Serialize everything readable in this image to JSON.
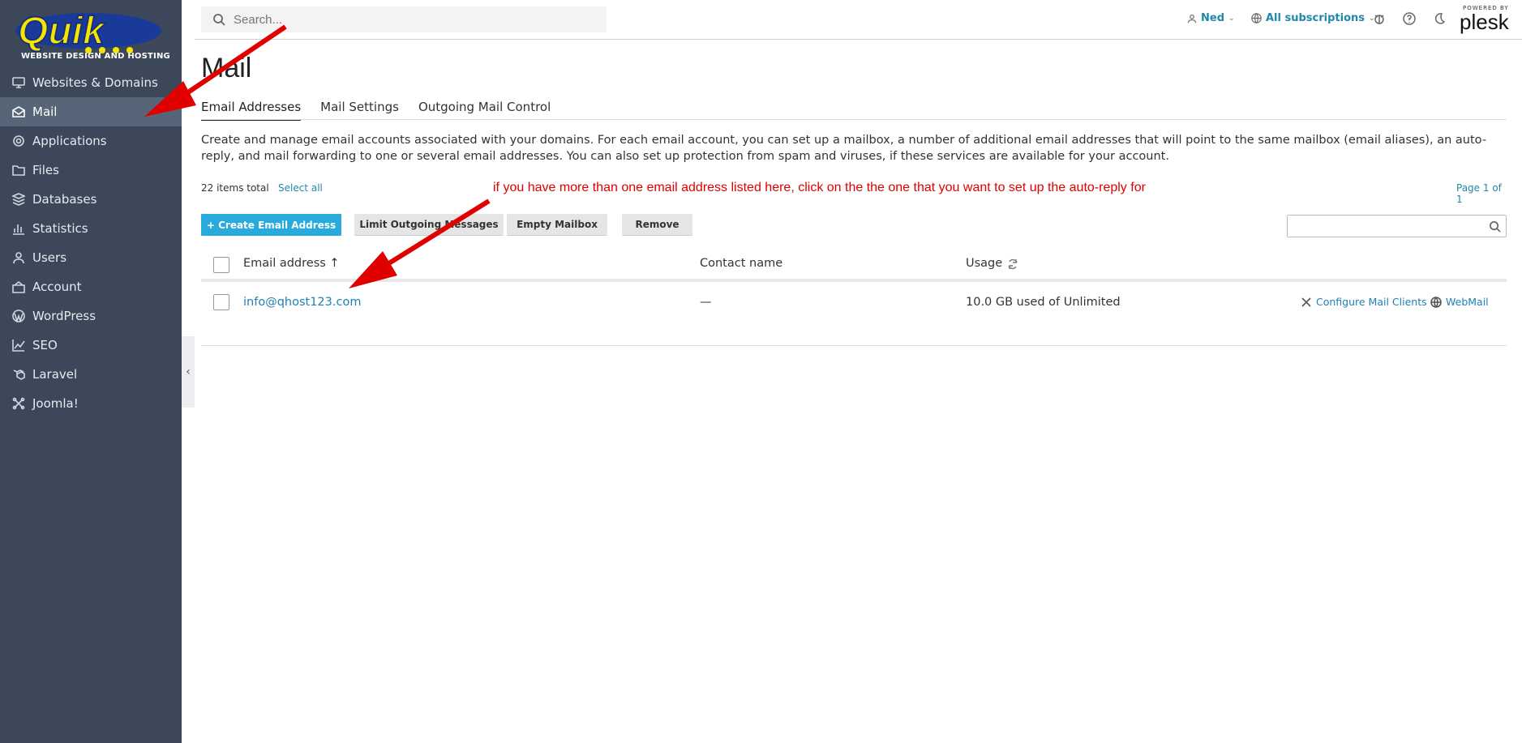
{
  "brand": {
    "logo_text": "Quik",
    "logo_subtitle": "WEBSITE DESIGN AND HOSTING"
  },
  "sidebar": {
    "items": [
      {
        "label": "Websites & Domains",
        "icon": "monitor-icon"
      },
      {
        "label": "Mail",
        "icon": "mail-icon",
        "active": true
      },
      {
        "label": "Applications",
        "icon": "gear-icon"
      },
      {
        "label": "Files",
        "icon": "folder-icon"
      },
      {
        "label": "Databases",
        "icon": "database-icon"
      },
      {
        "label": "Statistics",
        "icon": "chart-icon"
      },
      {
        "label": "Users",
        "icon": "user-icon"
      },
      {
        "label": "Account",
        "icon": "account-icon"
      },
      {
        "label": "WordPress",
        "icon": "wordpress-icon"
      },
      {
        "label": "SEO",
        "icon": "seo-icon"
      },
      {
        "label": "Laravel",
        "icon": "laravel-icon"
      },
      {
        "label": "Joomla!",
        "icon": "joomla-icon"
      }
    ],
    "collapse_glyph": "‹"
  },
  "topbar": {
    "search_placeholder": "Search...",
    "user_label": "Ned",
    "subscriptions_label": "All subscriptions",
    "powered_by": "POWERED BY",
    "plesk": "plesk"
  },
  "main": {
    "title": "Mail",
    "tabs": [
      "Email Addresses",
      "Mail Settings",
      "Outgoing Mail Control"
    ],
    "description": "Create and manage email accounts associated with your domains. For each email account, you can set up a mailbox, a number of additional email addresses that will point to the same mailbox (email aliases), an auto-reply, and mail forwarding to one or several email addresses. You can also set up protection from spam and viruses, if these services are available for your account.",
    "items_total": "22 items total",
    "select_all": "Select all",
    "page_info": "Page 1 of 1",
    "annotation": "if you have more than one email address listed here, click on the the one that you want to set up the auto-reply for",
    "buttons": {
      "create": "+  Create Email Address",
      "limit": "Limit Outgoing Messages",
      "empty": "Empty Mailbox",
      "remove": "Remove"
    },
    "table": {
      "columns": [
        "Email address ↑",
        "Contact name",
        "Usage"
      ],
      "rows": [
        {
          "email": "info@qhost123.com",
          "contact": "—",
          "usage": "10.0 GB used of Unlimited"
        }
      ],
      "actions": [
        "Configure Mail Clients",
        "WebMail"
      ]
    }
  },
  "colors": {
    "sidebar": "#3c4859",
    "accent": "#28aadc",
    "link": "#1f7fb5",
    "annotation": "#e00000"
  }
}
